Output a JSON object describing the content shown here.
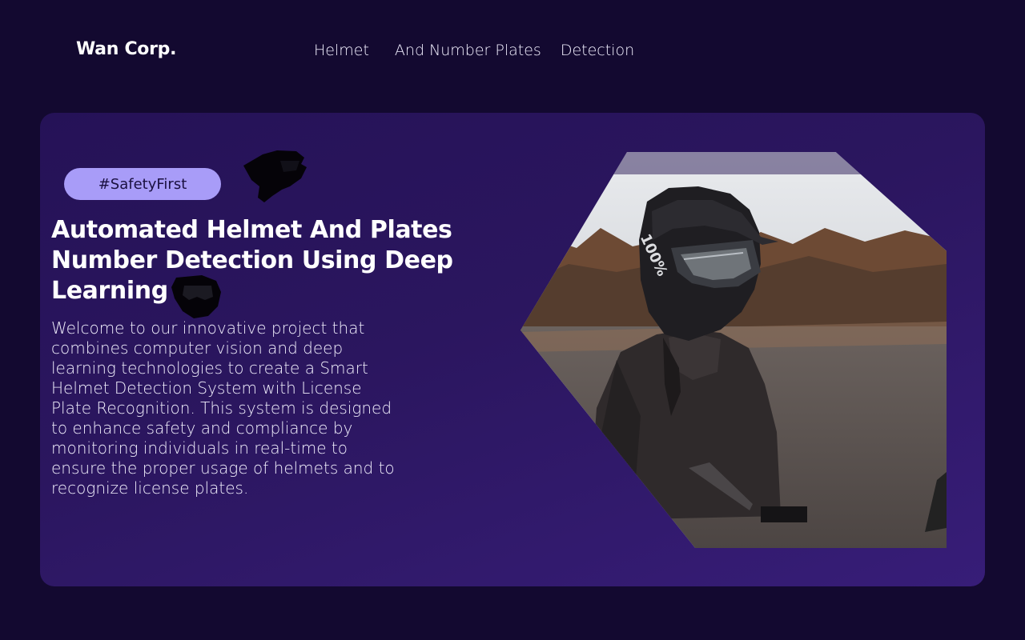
{
  "header": {
    "brand": "Wan Corp.",
    "nav": [
      "Helmet",
      "And Number Plates",
      "Detection"
    ]
  },
  "hero": {
    "tag": "#SafetyFirst",
    "title": " Automated Helmet And Plates Number Detection Using Deep Learning",
    "description": "Welcome to our innovative project that combines computer vision and deep learning technologies to create a Smart Helmet Detection System with License Plate Recognition. This system is designed to enhance safety and compliance by monitoring individuals in real-time to ensure the proper usage of helmets and to recognize license plates.",
    "image": {
      "subject": "rider wearing motocross helmet and goggles",
      "helmet_text": "100%"
    }
  },
  "colors": {
    "background": "#130930",
    "hero_panel": "#2b165f",
    "tag_bg": "#a89cf8",
    "tag_text": "#1a1040",
    "text": "#ffffff"
  },
  "icons": [
    "helmet-icon",
    "goggles-icon"
  ]
}
